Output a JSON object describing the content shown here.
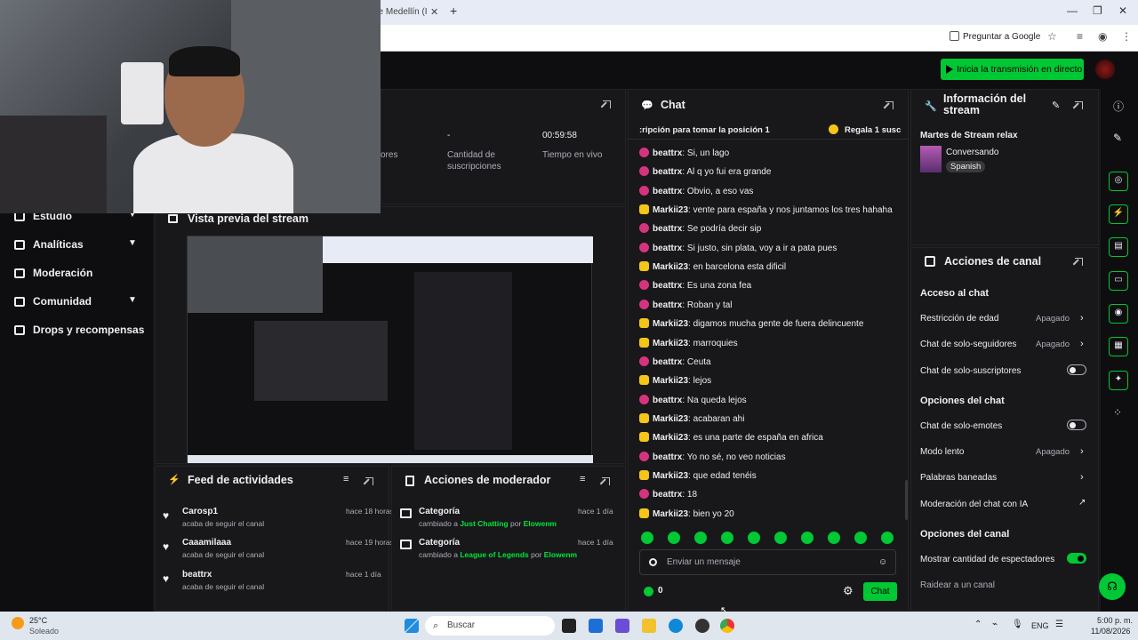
{
  "browser": {
    "tab_title": "de Medellín (I",
    "new_tab": "+",
    "translate_button": "Preguntar a Google"
  },
  "topbar": {
    "go_live_label": "Inicia la transmisión en directo"
  },
  "left_nav": {
    "items": [
      {
        "label": "Estudio"
      },
      {
        "label": "Analíticas"
      },
      {
        "label": "Moderación"
      },
      {
        "label": "Comunidad"
      },
      {
        "label": "Drops y recompensas"
      }
    ]
  },
  "stats": {
    "partial_label": "ores",
    "subs_value": "-",
    "subs_label": "Cantidad de suscripciones",
    "time_value": "00:59:58",
    "time_label": "Tiempo en vivo"
  },
  "preview": {
    "title": "Vista previa del stream"
  },
  "activity_feed": {
    "title": "Feed de actividades",
    "items": [
      {
        "user": "Carosp1",
        "text": "acaba de seguir el canal",
        "time": "hace 18 horas"
      },
      {
        "user": "Caaamilaaa",
        "text": "acaba de seguir el canal",
        "time": "hace 19 horas"
      },
      {
        "user": "beattrx",
        "text": "acaba de seguir el canal",
        "time": "hace 1 día"
      }
    ]
  },
  "mod_actions": {
    "title": "Acciones de moderador",
    "items": [
      {
        "title": "Categoría",
        "prefix": "cambiado a ",
        "value": "Just Chatting",
        "by": " por ",
        "user": "Elowenm",
        "time": "hace 1 día"
      },
      {
        "title": "Categoría",
        "prefix": "cambiado a ",
        "value": "League of Legends",
        "by": " por ",
        "user": "Elowenm",
        "time": "hace 1 día"
      }
    ]
  },
  "chat": {
    "title": "Chat",
    "pinned_left": ":ripción para tomar la posición 1",
    "pinned_right": "Regala 1 susc",
    "messages": [
      {
        "badge": "b1",
        "user": "beattrx",
        "text": "Si, un lago"
      },
      {
        "badge": "b1",
        "user": "beattrx",
        "text": "Al q yo fui era grande"
      },
      {
        "badge": "b1",
        "user": "beattrx",
        "text": "Obvio, a eso vas"
      },
      {
        "badge": "b2",
        "user": "Markii23",
        "text": "vente para españa y nos juntamos los tres hahaha"
      },
      {
        "badge": "b1",
        "user": "beattrx",
        "text": "Se podría decir sip"
      },
      {
        "badge": "b1",
        "user": "beattrx",
        "text": "Si justo, sin plata, voy a ir a pata pues"
      },
      {
        "badge": "b2",
        "user": "Markii23",
        "text": "en barcelona esta dificil"
      },
      {
        "badge": "b1",
        "user": "beattrx",
        "text": "Es una zona fea"
      },
      {
        "badge": "b1",
        "user": "beattrx",
        "text": "Roban y tal"
      },
      {
        "badge": "b2",
        "user": "Markii23",
        "text": "digamos mucha gente de fuera delincuente"
      },
      {
        "badge": "b2",
        "user": "Markii23",
        "text": "marroquies"
      },
      {
        "badge": "b1",
        "user": "beattrx",
        "text": "Ceuta"
      },
      {
        "badge": "b2",
        "user": "Markii23",
        "text": "lejos"
      },
      {
        "badge": "b1",
        "user": "beattrx",
        "text": "Na queda lejos"
      },
      {
        "badge": "b2",
        "user": "Markii23",
        "text": "acabaran ahi"
      },
      {
        "badge": "b2",
        "user": "Markii23",
        "text": "es una parte de españa en africa"
      },
      {
        "badge": "b1",
        "user": "beattrx",
        "text": "Yo no sé, no veo noticias"
      },
      {
        "badge": "b2",
        "user": "Markii23",
        "text": "que edad tenéis"
      },
      {
        "badge": "b1",
        "user": "beattrx",
        "text": "18"
      },
      {
        "badge": "b2",
        "user": "Markii23",
        "text": "bien yo 20"
      }
    ],
    "input_placeholder": "Enviar un mensaje",
    "points": "0",
    "send_label": "Chat"
  },
  "stream_info": {
    "title": "Información del stream",
    "stream_title": "Martes de Stream relax",
    "category": "Conversando",
    "language": "Spanish"
  },
  "channel_actions": {
    "title": "Acciones de canal",
    "chat_access_heading": "Acceso al chat",
    "age_restriction": "Restricción de edad",
    "age_restriction_value": "Apagado",
    "followers_only": "Chat de solo-seguidores",
    "followers_only_value": "Apagado",
    "subs_only": "Chat de solo-suscriptores",
    "chat_options_heading": "Opciones del chat",
    "emotes_only": "Chat de solo-emotes",
    "slow_mode": "Modo lento",
    "slow_mode_value": "Apagado",
    "banned_words": "Palabras baneadas",
    "ai_moderation": "Moderación del chat con IA",
    "channel_options_heading": "Opciones del canal",
    "show_viewers": "Mostrar cantidad de espectadores",
    "raid": "Raidear a un canal"
  },
  "taskbar": {
    "weather_temp": "25°C",
    "weather_desc": "Soleado",
    "search_placeholder": "Buscar",
    "lang": "ENG",
    "time": "5:00 p. m.",
    "date": "11/08/2026"
  }
}
